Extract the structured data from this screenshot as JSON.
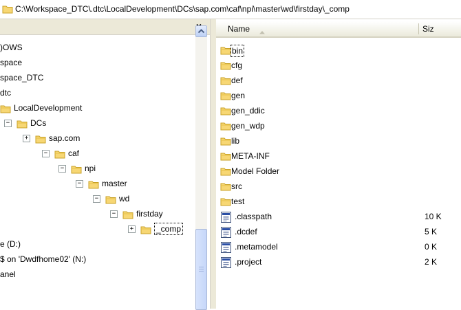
{
  "address_bar": {
    "path": "C:\\Workspace_DTC\\.dtc\\LocalDevelopment\\DCs\\sap.com\\caf\\npi\\master\\wd\\firstday\\_comp"
  },
  "tree_pane": {
    "close_label": "×",
    "items": [
      {
        "label": ")OWS",
        "expander": "",
        "icon": "none"
      },
      {
        "label": "space",
        "expander": "",
        "icon": "none"
      },
      {
        "label": "space_DTC",
        "expander": "",
        "icon": "none"
      },
      {
        "label": "dtc",
        "expander": "",
        "icon": "none"
      },
      {
        "label": "LocalDevelopment",
        "expander": "",
        "icon": "folder"
      },
      {
        "label": "DCs",
        "expander": "⊟",
        "icon": "folder"
      },
      {
        "label": "sap.com",
        "expander": "+",
        "icon": "folder"
      },
      {
        "label": "caf",
        "expander": "−",
        "icon": "folder"
      },
      {
        "label": "npi",
        "expander": "−",
        "icon": "folder"
      },
      {
        "label": "master",
        "expander": "−",
        "icon": "folder"
      },
      {
        "label": "wd",
        "expander": "−",
        "icon": "folder"
      },
      {
        "label": "firstday",
        "expander": "−",
        "icon": "folder"
      },
      {
        "label": "_comp",
        "expander": "+",
        "icon": "folder",
        "selected": true
      },
      {
        "label": "e (D:)",
        "expander": "",
        "icon": "none"
      },
      {
        "label": "$ on 'Dwdfhome02' (N:)",
        "expander": "",
        "icon": "none"
      },
      {
        "label": "anel",
        "expander": "",
        "icon": "none"
      }
    ]
  },
  "file_list": {
    "col_name": "Name",
    "col_size": "Siz",
    "items": [
      {
        "name": "bin",
        "type": "folder",
        "size": ""
      },
      {
        "name": "cfg",
        "type": "folder",
        "size": ""
      },
      {
        "name": "def",
        "type": "folder",
        "size": ""
      },
      {
        "name": "gen",
        "type": "folder",
        "size": ""
      },
      {
        "name": "gen_ddic",
        "type": "folder",
        "size": ""
      },
      {
        "name": "gen_wdp",
        "type": "folder",
        "size": ""
      },
      {
        "name": "lib",
        "type": "folder",
        "size": ""
      },
      {
        "name": "META-INF",
        "type": "folder",
        "size": ""
      },
      {
        "name": "Model Folder",
        "type": "folder",
        "size": ""
      },
      {
        "name": "src",
        "type": "folder",
        "size": ""
      },
      {
        "name": "test",
        "type": "folder",
        "size": ""
      },
      {
        "name": ".classpath",
        "type": "file",
        "size": "10 K"
      },
      {
        "name": ".dcdef",
        "type": "file",
        "size": "5 K"
      },
      {
        "name": ".metamodel",
        "type": "file",
        "size": "0 K"
      },
      {
        "name": ".project",
        "type": "file",
        "size": "2 K"
      }
    ]
  },
  "colors": {
    "folder_fill": "#f7d774",
    "folder_stroke": "#c9a227",
    "pane_header": "#ece9d8",
    "scrollbar_accent": "#c6d7f9"
  }
}
